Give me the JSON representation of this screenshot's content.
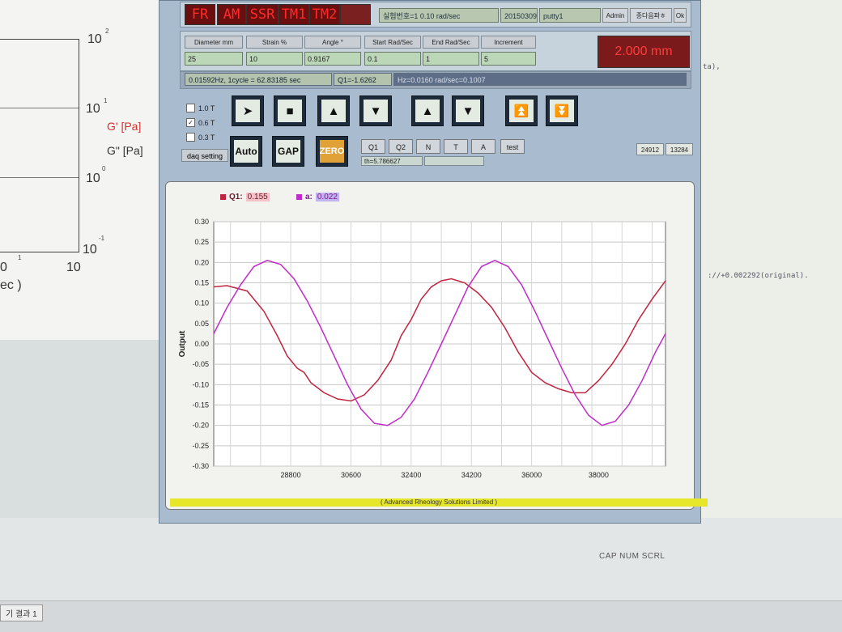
{
  "background": {
    "left_plot": {
      "tick_labels": [
        "10",
        "10",
        "10",
        "10",
        "10",
        "10"
      ],
      "tick_sups": [
        "2",
        "1",
        "0",
        "-1",
        "1"
      ],
      "gprime_label": "G' [Pa]",
      "gdouble_label": "G\" [Pa]",
      "xaxis_fragment": "ec )",
      "x0": "0"
    },
    "code_lines": [
      "ta),",
      "://+0.002292(original)."
    ],
    "statusbar": "CAP NUM SCRL",
    "taskbar_tab": "기 결과 1"
  },
  "top": {
    "leds": [
      "FR",
      "AM",
      "SSR",
      "TM1",
      "TM2"
    ],
    "info": "실험번호=1   0.10 rad/sec",
    "date": "20150309",
    "sample": "putty1",
    "user_button": "Admin",
    "close_button": "종다음파ㅎ",
    "ok_button": "Ok"
  },
  "params": {
    "headers": [
      "Diameter mm",
      "Strain  %",
      "Angle °",
      "Start Rad/Sec",
      "End Rad/Sec",
      "Increment"
    ],
    "values": [
      "25",
      "10",
      "0.9167",
      "0.1",
      "1",
      "5"
    ],
    "display": "2.000 mm"
  },
  "status_line": {
    "freq": "0.01592Hz, 1cycle = 62.83185 sec",
    "q1": "Q1=-1.6262",
    "hz": "Hz=0.0160  rad/sec=0.1007"
  },
  "controls": {
    "checks": [
      {
        "label": "1.0 T",
        "checked": false
      },
      {
        "label": "0.6 T",
        "checked": true
      },
      {
        "label": "0.3 T",
        "checked": false
      }
    ],
    "daq_label": "daq setting",
    "auto_label": "Auto",
    "gap_label": "GAP",
    "zero_label": "ZERO",
    "qbuttons": [
      "Q1",
      "Q2",
      "N",
      "T",
      "A"
    ],
    "test_label": "test",
    "th_value": "th=5.786627",
    "counters": [
      "24912",
      "13284"
    ]
  },
  "chart_legend": {
    "q1_name": "Q1:",
    "q1_value": "0.155",
    "a_name": "a:",
    "a_value": "0.022"
  },
  "footer": "(  Advanced    Rheology    Solutions    Limited  )",
  "colors": {
    "q1": "#c0253f",
    "a": "#c02cc8",
    "led_text": "#ff2a2a",
    "footer_bar": "#e6e62a"
  },
  "chart_data": {
    "type": "line",
    "ylabel": "Output",
    "xlim": [
      26500,
      40000
    ],
    "ylim": [
      -0.3,
      0.3
    ],
    "yticks": [
      -0.3,
      -0.25,
      -0.2,
      -0.15,
      -0.1,
      -0.05,
      0.0,
      0.05,
      0.1,
      0.15,
      0.2,
      0.25,
      0.3
    ],
    "ytick_labels": [
      "-0.30",
      "-0.25",
      "-0.20",
      "-0.15",
      "-0.10",
      "-0.05",
      "0.00",
      "0.05",
      "0.10",
      "0.15",
      "0.20",
      "0.25",
      "0.30"
    ],
    "xticks": [
      28800,
      30600,
      32400,
      34200,
      36000,
      38000
    ],
    "xtick_labels": [
      "28800",
      "30600",
      "32400",
      "34200",
      "36000",
      "38000"
    ],
    "grid": true,
    "series": [
      {
        "name": "Q1",
        "x": [
          26500,
          26900,
          27500,
          28000,
          28400,
          28700,
          29000,
          29200,
          29400,
          29800,
          30200,
          30600,
          31000,
          31400,
          31800,
          32100,
          32400,
          32700,
          33000,
          33300,
          33600,
          34000,
          34400,
          34800,
          35200,
          35600,
          36000,
          36400,
          36800,
          37200,
          37600,
          38000,
          38400,
          38800,
          39200,
          39600,
          40000
        ],
        "y": [
          0.14,
          0.143,
          0.13,
          0.08,
          0.02,
          -0.03,
          -0.06,
          -0.07,
          -0.095,
          -0.12,
          -0.135,
          -0.14,
          -0.125,
          -0.09,
          -0.04,
          0.02,
          0.06,
          0.11,
          0.14,
          0.155,
          0.16,
          0.15,
          0.125,
          0.09,
          0.04,
          -0.02,
          -0.07,
          -0.095,
          -0.11,
          -0.12,
          -0.12,
          -0.09,
          -0.05,
          0.0,
          0.06,
          0.11,
          0.155
        ]
      },
      {
        "name": "a",
        "x": [
          26500,
          26900,
          27300,
          27700,
          28100,
          28500,
          28900,
          29300,
          29700,
          30100,
          30500,
          30900,
          31300,
          31700,
          32100,
          32500,
          32900,
          33300,
          33700,
          34100,
          34500,
          34900,
          35300,
          35700,
          36100,
          36500,
          36900,
          37300,
          37700,
          38100,
          38500,
          38900,
          39300,
          39700,
          40000
        ],
        "y": [
          0.025,
          0.09,
          0.145,
          0.19,
          0.205,
          0.195,
          0.16,
          0.105,
          0.04,
          -0.03,
          -0.1,
          -0.16,
          -0.195,
          -0.2,
          -0.18,
          -0.135,
          -0.07,
          0.0,
          0.07,
          0.14,
          0.19,
          0.205,
          0.19,
          0.145,
          0.08,
          0.01,
          -0.06,
          -0.125,
          -0.175,
          -0.2,
          -0.19,
          -0.15,
          -0.09,
          -0.02,
          0.025
        ]
      }
    ]
  }
}
